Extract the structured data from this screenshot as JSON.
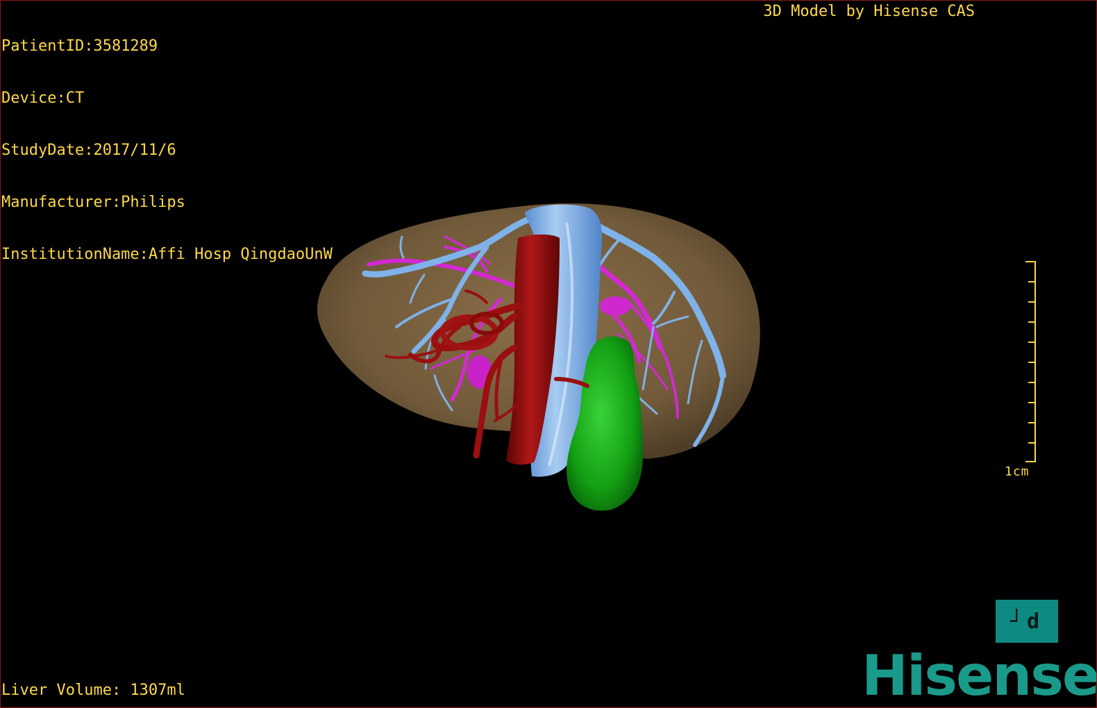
{
  "patient_info": {
    "patient_id": "PatientID:3581289",
    "device": "Device:CT",
    "study_date": "StudyDate:2017/11/6",
    "manufacturer": "Manufacturer:Philips",
    "institution": "InstitutionName:Affi Hosp QingdaoUnW"
  },
  "brand_line": "3D Model by Hisense CAS",
  "liver_volume": "Liver Volume: 1307ml",
  "scale": {
    "label": "1cm",
    "color": "#ffd94a"
  },
  "orientation_cube": {
    "label": "┘d",
    "color": "#0f8a82"
  },
  "logo": {
    "text": "Hisense",
    "color": "#1a9a8a"
  },
  "model_colors": {
    "liver": "#7a6242",
    "portal_vein": "#7fb2e8",
    "hepatic_vein": "#d024d0",
    "artery": "#8a0c0c",
    "tumor": "#1aa01a"
  }
}
